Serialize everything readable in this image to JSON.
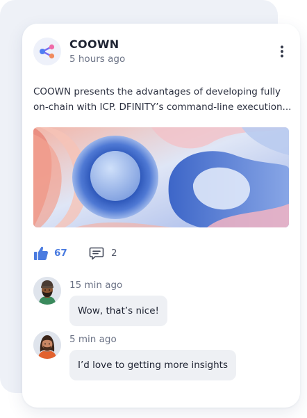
{
  "post": {
    "author": "COOWN",
    "time": "5 hours ago",
    "text": "COOWN presents the advantages of developing fully on-chain with ICP. DFINITY’s command-line execution...",
    "likes": "67",
    "comments_count": "2",
    "icons": {
      "avatar": "share-nodes-icon",
      "menu": "more-vertical-icon",
      "like": "thumbs-up-icon",
      "comment": "comment-icon"
    }
  },
  "comments": [
    {
      "time": "15 min ago",
      "text": "Wow, that’s nice!",
      "avatar": "user-avatar-beanie"
    },
    {
      "time": "5 min ago",
      "text": "I’d love to getting more insights",
      "avatar": "user-avatar-long-hair"
    }
  ],
  "colors": {
    "accent": "#4a7be0",
    "card_background": "#ffffff",
    "back_card": "#eef1f7",
    "bubble": "#eef0f4"
  }
}
